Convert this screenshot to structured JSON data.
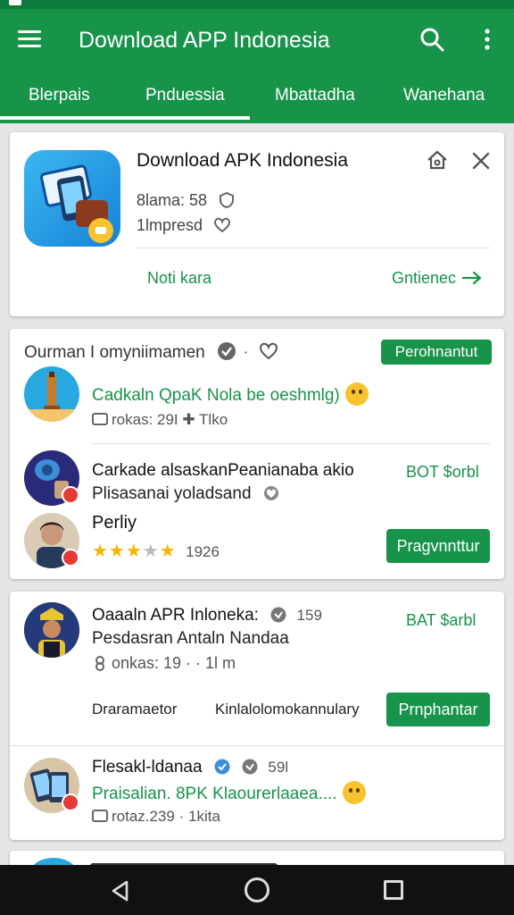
{
  "app": {
    "title": "Download APP Indonesia"
  },
  "tabs": [
    {
      "label": "Blerpais"
    },
    {
      "label": "Pnduessia"
    },
    {
      "label": "Mbattadha"
    },
    {
      "label": "Wanehana"
    }
  ],
  "featured": {
    "name": "Download APK Indonesia",
    "meta1": "8lama: 58",
    "meta2": "1lmpresd",
    "link_left": "Noti kara",
    "link_right": "Gntienec"
  },
  "section": {
    "title": "Ourman I omyniimamen",
    "button": "Perohnantut",
    "item1": {
      "title": "Cadkaln QpaK  Nola be oeshmlg)",
      "meta": "rokas: 29I  ✚ Tlko"
    },
    "item2": {
      "title": "Carkade alsaskanPeanianaba akio",
      "subtitle": "Plisasanai yoladsand",
      "price": "BOT $orbl"
    },
    "item3": {
      "title": "Perliy",
      "rating": "1926",
      "button": "Pragvnnttur"
    }
  },
  "list": {
    "item1": {
      "title": "Oaaaln APR Inloneka:",
      "count": "159",
      "subtitle": "Pesdasran Antaln Nandaa",
      "meta": "onkas: 19 · · 1l m",
      "price": "BAT $arbl",
      "label_left": "Draramaetor",
      "label_mid": "Kinlalolomokannulary",
      "button": "Prnphantar"
    },
    "item2": {
      "title": "Flesakl-ldanaa",
      "count": "59l",
      "subtitle": "Praisalian. 8PK Klaourerlaaea....",
      "meta": "rotaz.239 · 1kita"
    }
  },
  "colors": {
    "primary": "#17934a",
    "statusbar": "#0f7a3e",
    "background": "#e6e6e6"
  }
}
